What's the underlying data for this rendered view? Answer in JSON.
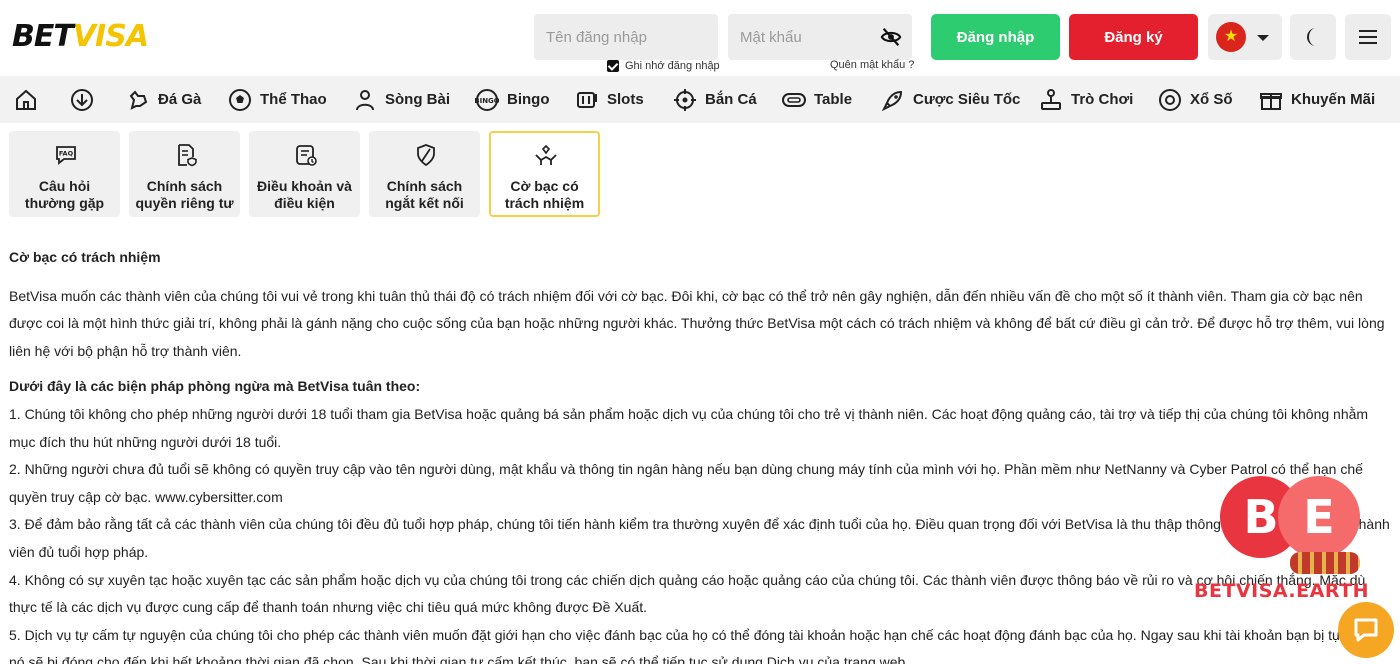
{
  "header": {
    "logo_part1": "BET",
    "logo_part2": "VISA",
    "username_placeholder": "Tên đăng nhập",
    "password_placeholder": "Mật khẩu",
    "remember_label": "Ghi nhớ đăng nhập",
    "forgot_label": "Quên mật khẩu ?",
    "login_label": "Đăng nhập",
    "register_label": "Đăng ký",
    "login_color": "#2ecc71",
    "register_color": "#e5202e",
    "accent_color": "#f5c400"
  },
  "nav": {
    "items": [
      {
        "label": "",
        "icon": "home-icon"
      },
      {
        "label": "",
        "icon": "download-icon"
      },
      {
        "label": "Đá Gà",
        "icon": "rooster-icon"
      },
      {
        "label": "Thể Thao",
        "icon": "soccer-ball-icon"
      },
      {
        "label": "Sòng Bài",
        "icon": "dealer-icon"
      },
      {
        "label": "Bingo",
        "icon": "bingo-icon"
      },
      {
        "label": "Slots",
        "icon": "slot-machine-icon"
      },
      {
        "label": "Bắn Cá",
        "icon": "target-icon"
      },
      {
        "label": "Table",
        "icon": "table-icon"
      },
      {
        "label": "Cược Siêu Tốc",
        "icon": "rocket-icon"
      },
      {
        "label": "Trò Chơi",
        "icon": "joystick-icon"
      },
      {
        "label": "Xổ Số",
        "icon": "lottery-ball-icon"
      },
      {
        "label": "Khuyến Mãi",
        "icon": "gift-icon"
      }
    ]
  },
  "tabs": [
    {
      "label": "Câu hỏi thường gặp",
      "icon": "faq-icon"
    },
    {
      "label": "Chính sách quyền riêng tư",
      "icon": "privacy-policy-icon"
    },
    {
      "label": "Điều khoản và điều kiện",
      "icon": "terms-icon"
    },
    {
      "label": "Chính sách ngắt kết nối",
      "icon": "disconnect-icon"
    },
    {
      "label": "Cờ bạc có trách nhiệm",
      "icon": "responsible-gaming-icon"
    }
  ],
  "content": {
    "title": "Cờ bạc có trách nhiệm",
    "intro": "BetVisa muốn các thành viên của chúng tôi vui vẻ trong khi tuân thủ thái độ có trách nhiệm đối với cờ bạc. Đôi khi, cờ bạc có thể trở nên gây nghiện, dẫn đến nhiều vấn đề cho một số ít thành viên. Tham gia cờ bạc nên được coi là một hình thức giải trí, không phải là gánh nặng cho cuộc sống của bạn hoặc những người khác. Thưởng thức BetVisa một cách có trách nhiệm và không để bất cứ điều gì cản trở. Để được hỗ trợ thêm, vui lòng liên hệ với bộ phận hỗ trợ thành viên.",
    "measures_heading": "Dưới đây là các biện pháp phòng ngừa mà BetVisa tuân theo:",
    "measures": [
      "1. Chúng tôi không cho phép những người dưới 18 tuổi tham gia BetVisa hoặc quảng bá sản phẩm hoặc dịch vụ của chúng tôi cho trẻ vị thành niên. Các hoạt động quảng cáo, tài trợ và tiếp thị của chúng tôi không nhằm mục đích thu hút những người dưới 18 tuổi.",
      "2. Những người chưa đủ tuổi sẽ không có quyền truy cập vào tên người dùng, mật khẩu và thông tin ngân hàng nếu bạn dùng chung máy tính của mình với họ. Phần mềm như NetNanny và Cyber Patrol có thể hạn chế quyền truy cập cờ bạc. www.cybersitter.com",
      "3. Để đảm bảo rằng tất cả các thành viên của chúng tôi đều đủ tuổi hợp pháp, chúng tôi tiến hành kiểm tra thường xuyên để xác định tuổi của họ. Điều quan trọng đối với BetVisa là thu thập thông tin để xác minh rằng thành viên đủ tuổi hợp pháp.",
      "4. Không có sự xuyên tạc hoặc xuyên tạc các sản phẩm hoặc dịch vụ của chúng tôi trong các chiến dịch quảng cáo hoặc quảng cáo của chúng tôi. Các thành viên được thông báo về rủi ro và cơ hội chiến thắng. Mặc dù thực tế là các dịch vụ được cung cấp để thanh toán nhưng việc chi tiêu quá mức không được Đề Xuất.",
      "5. Dịch vụ tự cấm tự nguyện của chúng tôi cho phép các thành viên muốn đặt giới hạn cho việc đánh bạc của họ có thể đóng tài khoản hoặc hạn chế các hoạt động đánh bạc của họ. Ngay sau khi tài khoản bạn bị tự loại trừ, nó sẽ bị đóng cho đến khi hết khoảng thời gian đã chọn. Sau khi thời gian tự cấm kết thúc, bạn sẽ có thể tiếp tục sử dụng Dịch vụ của trang web."
    ]
  },
  "watermark": {
    "letter_b": "B",
    "letter_e": "E",
    "text": "BETVISA.EARTH"
  }
}
